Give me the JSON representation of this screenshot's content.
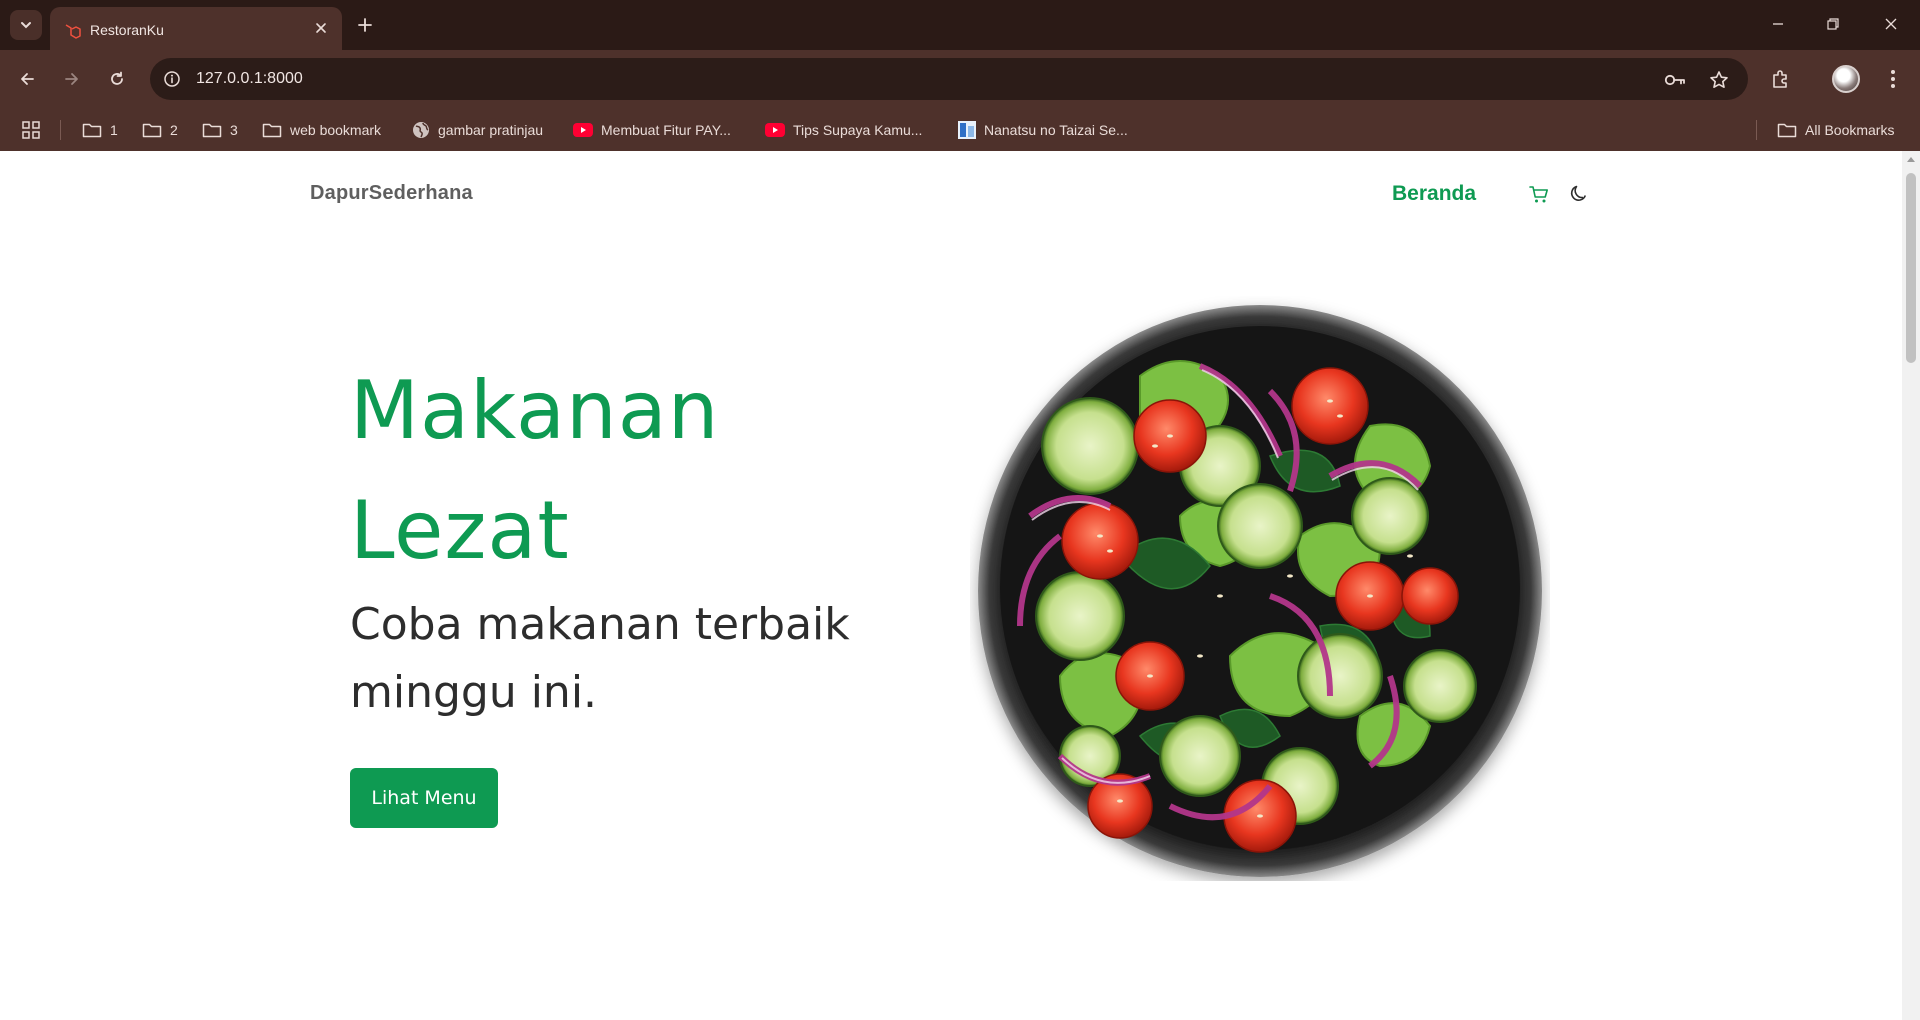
{
  "browser": {
    "tab": {
      "title": "RestoranKu"
    },
    "url": "127.0.0.1:8000",
    "bookmarks": [
      {
        "label": "1",
        "icon": "folder-icon"
      },
      {
        "label": "2",
        "icon": "folder-icon"
      },
      {
        "label": "3",
        "icon": "folder-icon"
      },
      {
        "label": "web bookmark",
        "icon": "folder-icon"
      },
      {
        "label": "gambar pratinjau",
        "icon": "globe-icon"
      },
      {
        "label": "Membuat Fitur PAY...",
        "icon": "youtube-icon"
      },
      {
        "label": "Tips Supaya Kamu...",
        "icon": "youtube-icon"
      },
      {
        "label": "Nanatsu no Taizai Se...",
        "icon": "site-icon"
      }
    ],
    "all_bookmarks": "All Bookmarks",
    "colors": {
      "frame": "#2b1a16",
      "toolbar": "#4e312b",
      "omnibox": "#2c1c18"
    }
  },
  "site": {
    "brand": "DapurSederhana",
    "nav": {
      "home": "Beranda"
    },
    "icons": {
      "cart": "cart-icon",
      "theme": "moon-icon"
    },
    "hero": {
      "title_line1": "Makanan",
      "title_line2": "Lezat",
      "subtitle": "Coba makanan terbaik minggu ini.",
      "cta": "Lihat Menu"
    },
    "colors": {
      "accent": "#0e9a52",
      "text": "#2d2d2d",
      "brand": "#5f5f5f"
    }
  }
}
